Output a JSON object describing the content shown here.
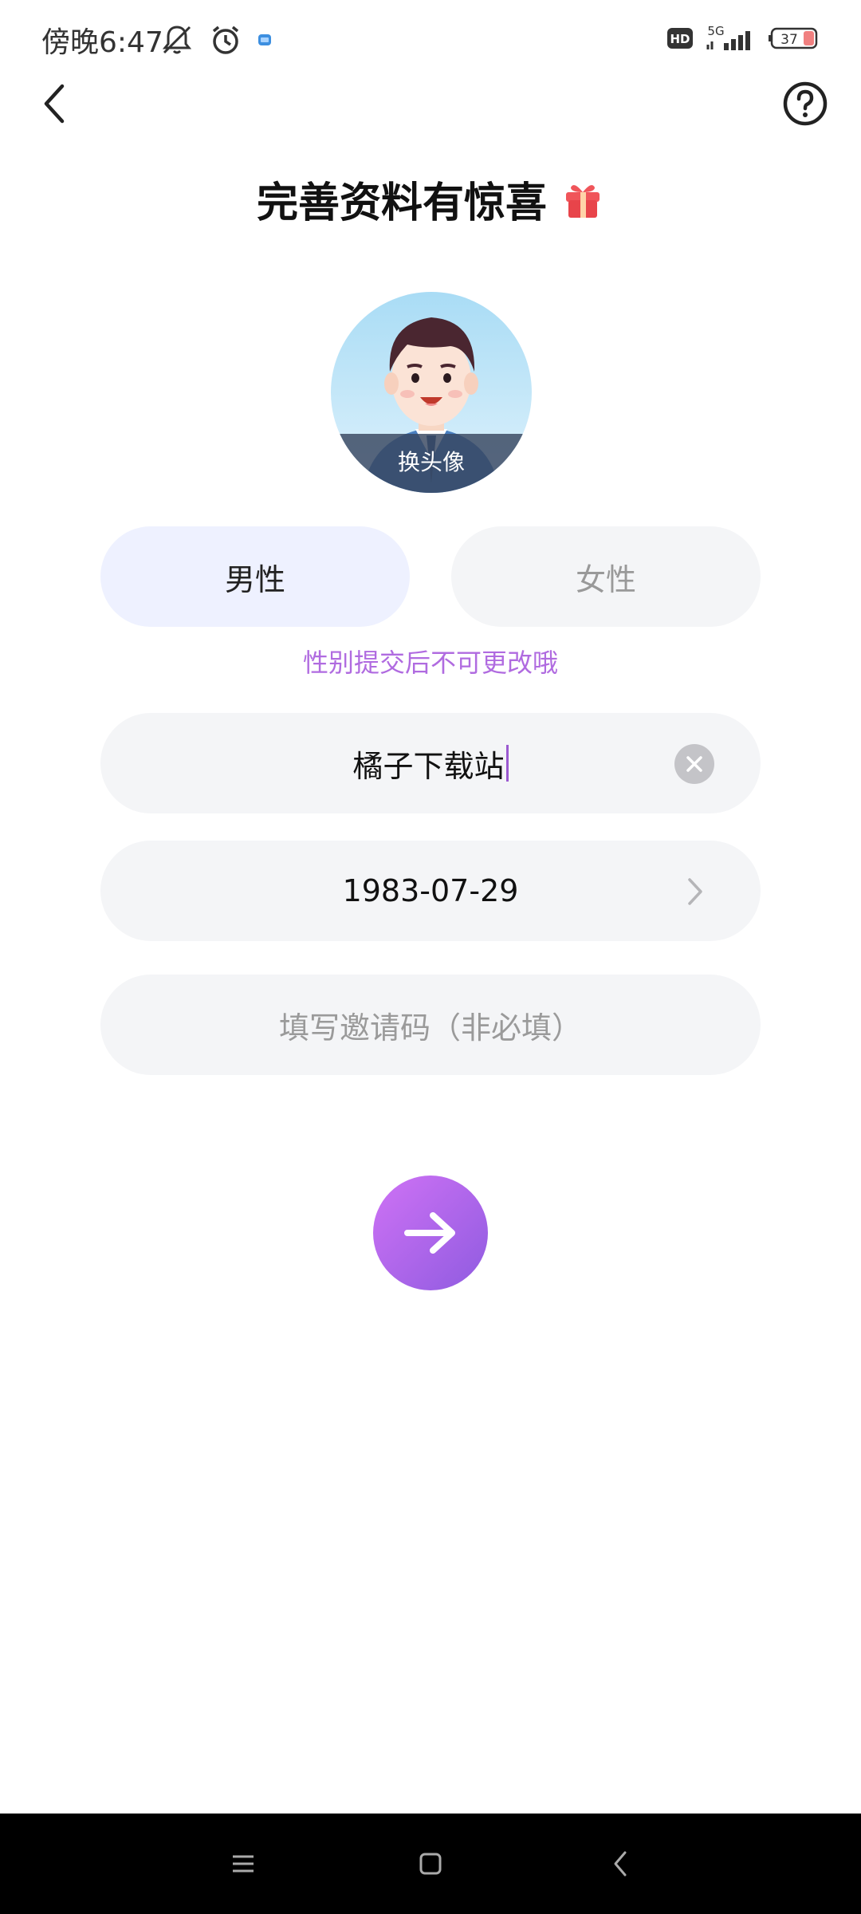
{
  "status_bar": {
    "time": "傍晚6:47",
    "battery": "37",
    "network": "5G",
    "hd": "HD"
  },
  "header": {
    "title": "完善资料有惊喜",
    "back_icon": "chevron-left-icon",
    "help_icon": "question-circle-icon"
  },
  "avatar": {
    "change_label": "换头像"
  },
  "gender": {
    "male_label": "男性",
    "female_label": "女性",
    "selected": "male",
    "hint": "性别提交后不可更改哦"
  },
  "form": {
    "nickname_value": "橘子下载站",
    "birthday_value": "1983-07-29",
    "invite_placeholder": "填写邀请码（非必填）"
  },
  "colors": {
    "accent": "#b06be0",
    "button_gradient_start": "#cf72f5",
    "button_gradient_end": "#8f5be0",
    "selected_bg": "#eef1ff",
    "field_bg": "#f4f5f7"
  }
}
